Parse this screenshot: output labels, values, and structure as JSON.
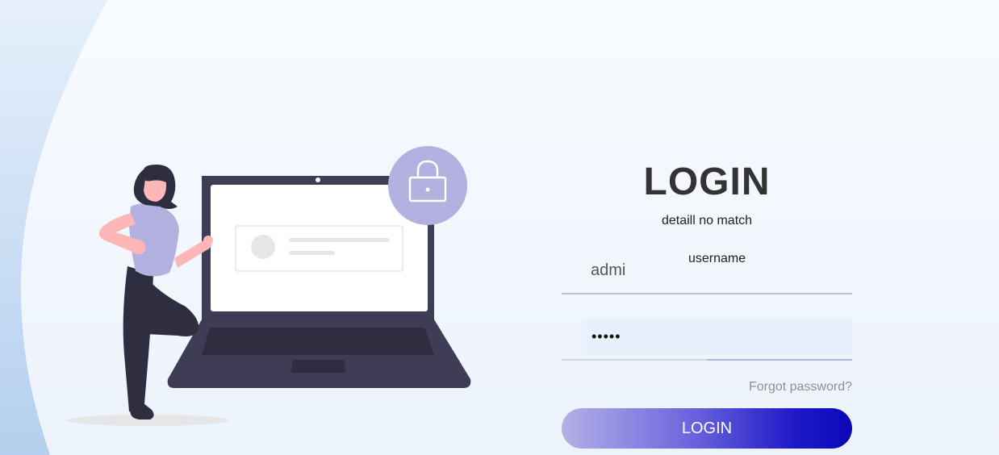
{
  "login": {
    "title": "LOGIN",
    "error_message": "detaill no match",
    "username_label": "username",
    "username_value": "admi",
    "password_value": "•••••",
    "forgot_password": "Forgot password?",
    "button_label": "LOGIN"
  },
  "colors": {
    "accent": "#b3b1e0",
    "button_start": "#b5b0e6",
    "button_end": "#0b07b8",
    "laptop": "#3f3d56",
    "background": "#f4f8fe"
  },
  "icons": {
    "lock": "lock-icon",
    "illustration": "woman-with-laptop-illustration"
  }
}
